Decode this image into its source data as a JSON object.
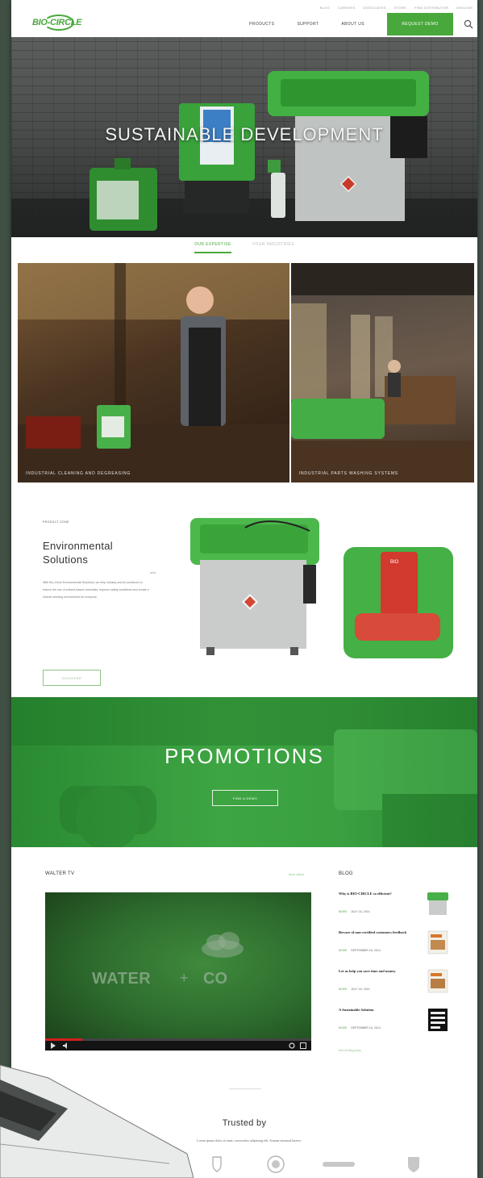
{
  "top_links": [
    "BLOG",
    "CAREERS",
    "ASSOCIATES",
    "STORE",
    "FIND DISTRIBUTOR",
    "ENGLISH"
  ],
  "logo": {
    "text": "BIO-CIRCLE"
  },
  "nav": {
    "items": [
      "PRODUCTS",
      "SUPPORT",
      "ABOUT US"
    ],
    "cta": "REQUEST DEMO"
  },
  "hero": {
    "title": "SUSTAINABLE DEVELOPMENT"
  },
  "tabs": [
    {
      "label": "OUR EXPERTISE",
      "active": true
    },
    {
      "label": "YOUR INDUSTRIES",
      "active": false
    }
  ],
  "panels": [
    {
      "caption": "INDUSTRIAL CLEANING AND DEGREASING"
    },
    {
      "caption": "INDUSTRIAL PARTS WASHING SYSTEMS"
    }
  ],
  "product": {
    "eyebrow": "PRODUCT ZONE",
    "title": "Environmental Solutions",
    "body": "With Bio-Circle Environmental Solutions, we help industry and its workforce to reduce the use of solvent-based chemicals, improve safety conditions and create a cleaner working environment for everyone.",
    "stub": "zero.",
    "button": "DISCOVER"
  },
  "promo": {
    "title": "PROMOTIONS",
    "button": "FIND A DEMO"
  },
  "walter_tv": {
    "heading": "WALTER TV",
    "more": "More videos",
    "video_text_left": "WATER",
    "video_plus": "+",
    "video_text_right": "CO",
    "progress": 0.14
  },
  "blog": {
    "heading": "BLOG",
    "items": [
      {
        "title": "Why is BIO-CIRCLE so efficient?",
        "category": "NEWS",
        "date": "JULY 16, 2014",
        "thumb": "parts-washer"
      },
      {
        "title": "Beware of non-certified customers feedback",
        "category": "NEWS",
        "date": "SEPTEMBER 16, 2014",
        "thumb": "magazine"
      },
      {
        "title": "Let us help you save time and money",
        "category": "NEWS",
        "date": "JULY 16, 2014",
        "thumb": "magazine"
      },
      {
        "title": "A Sustainable Solution",
        "category": "NEWS",
        "date": "SEPTEMBER 16, 2014",
        "thumb": "global-show"
      }
    ],
    "footer": "See all blog posts"
  },
  "trusted": {
    "title": "Trusted by",
    "subtitle": "Lorem ipsum dolor sit amet, consectetur adipiscing elit. Aenean euismod laoreet."
  },
  "colors": {
    "brand_green": "#49a83b",
    "promo_green": "#3ea543",
    "text_dark": "#333333"
  }
}
